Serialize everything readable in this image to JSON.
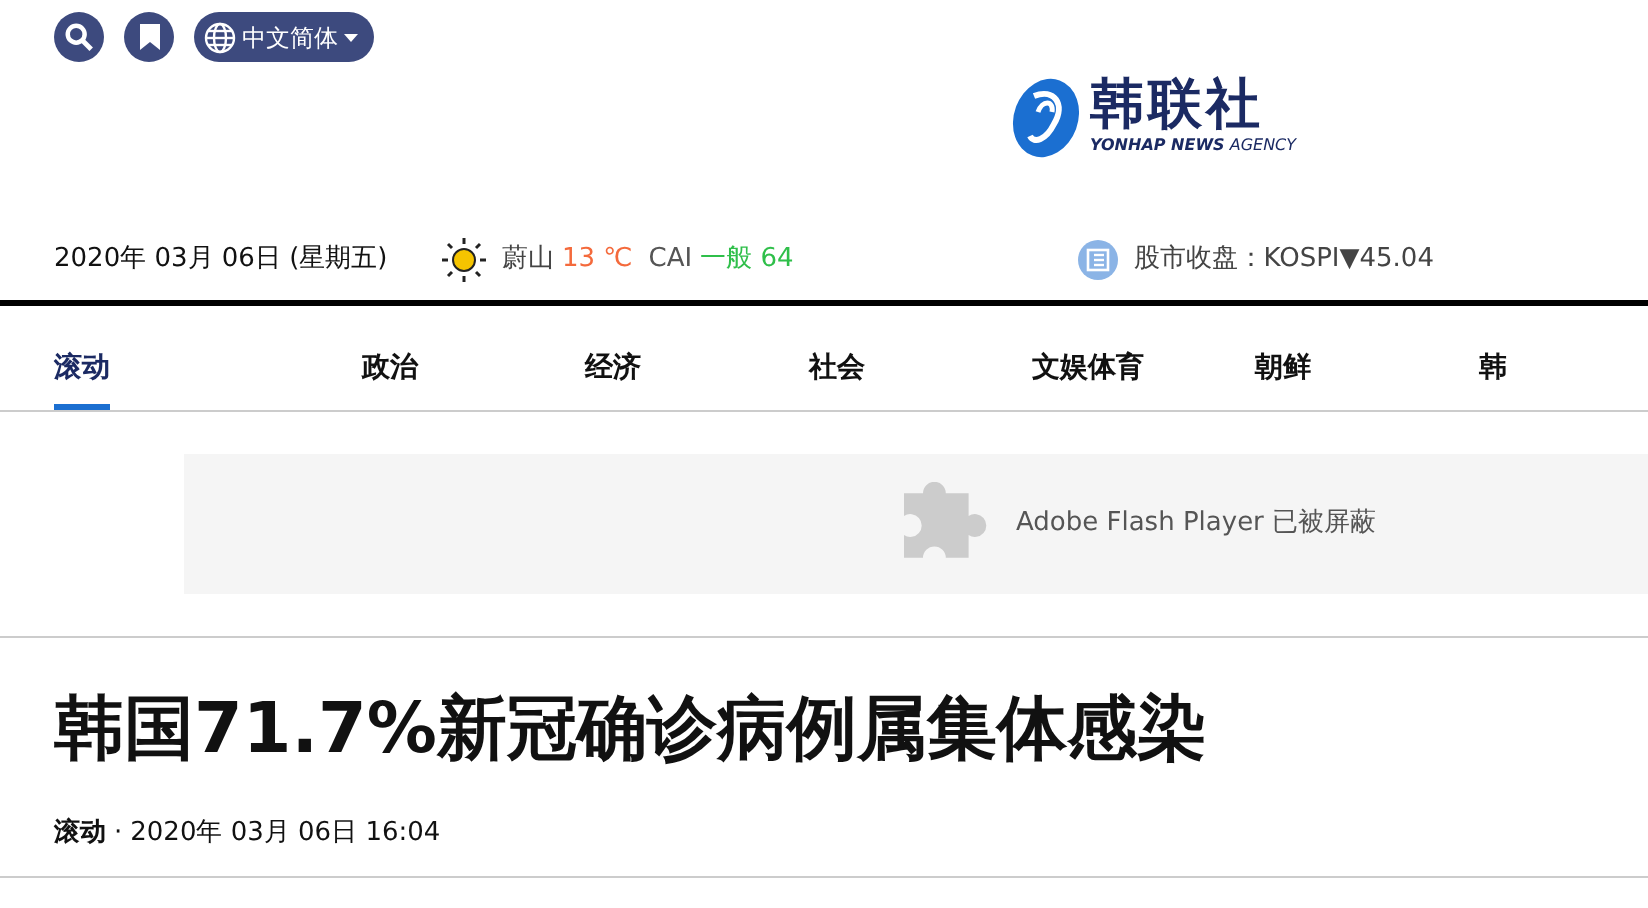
{
  "top_bar": {
    "language": "中文简体"
  },
  "logo": {
    "name": "韩联社",
    "subtitle_bold": "YONHAP NEWS",
    "subtitle": "AGENCY"
  },
  "info_bar": {
    "date": "2020年 03月 06日 (星期五)",
    "city": "蔚山",
    "temperature": "13 ℃",
    "cai_label": "CAI",
    "cai_value": "一般 64",
    "stock": "股市收盘：KOSPI▼45.04"
  },
  "nav": [
    {
      "label": "滚动",
      "selected": true
    },
    {
      "label": "政治",
      "selected": false
    },
    {
      "label": "经济",
      "selected": false
    },
    {
      "label": "社会",
      "selected": false
    },
    {
      "label": "文娱体育",
      "selected": false
    },
    {
      "label": "朝鲜",
      "selected": false
    },
    {
      "label": "韩",
      "selected": false
    }
  ],
  "plugin_notice": "Adobe Flash Player 已被屏蔽",
  "article": {
    "headline": "韩国71.7%新冠确诊病例属集体感染",
    "category": "滚动",
    "separator": "·",
    "time": "2020年 03月 06日 16:04"
  }
}
